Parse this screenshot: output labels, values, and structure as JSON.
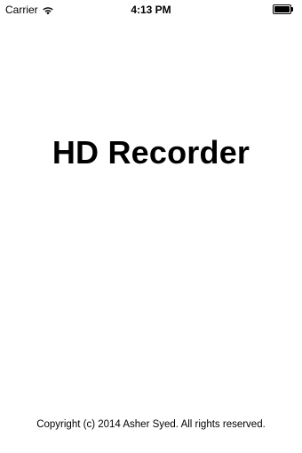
{
  "status_bar": {
    "carrier": "Carrier",
    "time": "4:13 PM",
    "wifi_icon": "wifi-icon",
    "battery_icon": "battery-icon",
    "battery_level": 1.0
  },
  "splash": {
    "title": "HD Recorder",
    "copyright": "Copyright (c) 2014 Asher Syed. All rights reserved."
  },
  "colors": {
    "background": "#ffffff",
    "text": "#000000"
  }
}
